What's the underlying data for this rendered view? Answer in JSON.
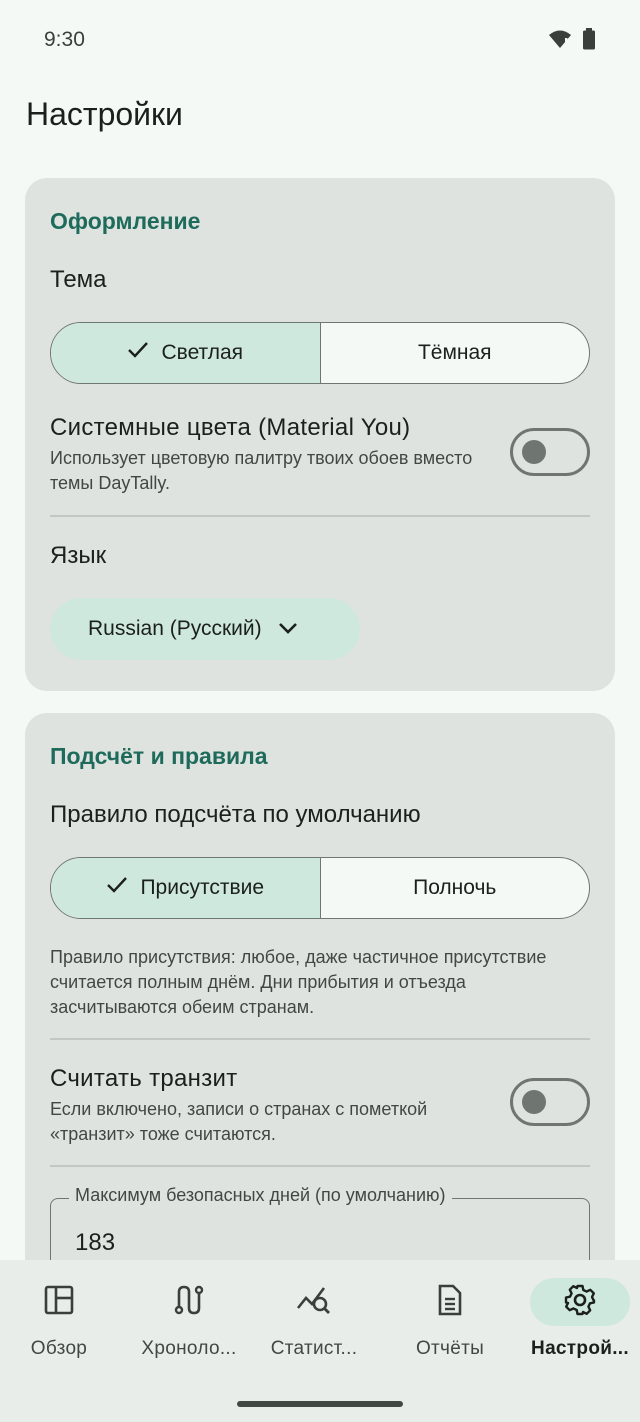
{
  "status_bar": {
    "time": "9:30"
  },
  "page": {
    "title": "Настройки"
  },
  "appearance": {
    "section_title": "Оформление",
    "theme_label": "Тема",
    "theme_options": [
      {
        "label": "Светлая",
        "selected": true
      },
      {
        "label": "Тёмная",
        "selected": false
      }
    ],
    "system_colors": {
      "title": "Системные цвета (Material You)",
      "description": "Использует цветовую палитру твоих обоев вместо темы DayTally.",
      "enabled": false
    },
    "language_label": "Язык",
    "language_value": "Russian (Русский)"
  },
  "counting": {
    "section_title": "Подсчёт и правила",
    "default_rule_label": "Правило подсчёта по умолчанию",
    "rule_options": [
      {
        "label": "Присутствие",
        "selected": true
      },
      {
        "label": "Полночь",
        "selected": false
      }
    ],
    "rule_hint": "Правило присутствия: любое, даже частичное присутствие считается полным днём. Дни прибытия и отъезда засчитываются обеим странам.",
    "transit": {
      "title": "Считать транзит",
      "description": "Если включено, записи о странах с пометкой «транзит» тоже считаются.",
      "enabled": false
    },
    "max_safe_days": {
      "label": "Максимум безопасных дней (по умолчанию)",
      "value": "183"
    }
  },
  "bottom_nav": {
    "items": [
      {
        "label": "Обзор",
        "icon": "dashboard-icon",
        "active": false
      },
      {
        "label": "Хроноло...",
        "icon": "timeline-icon",
        "active": false
      },
      {
        "label": "Статист...",
        "icon": "stats-icon",
        "active": false
      },
      {
        "label": "Отчёты",
        "icon": "document-icon",
        "active": false
      },
      {
        "label": "Настрой...",
        "icon": "gear-icon",
        "active": true
      }
    ]
  },
  "colors": {
    "accent": "#1e6b5c",
    "selected_bg": "#cfe8dd",
    "card_bg": "#dfe3df",
    "page_bg": "#f4f9f5"
  }
}
